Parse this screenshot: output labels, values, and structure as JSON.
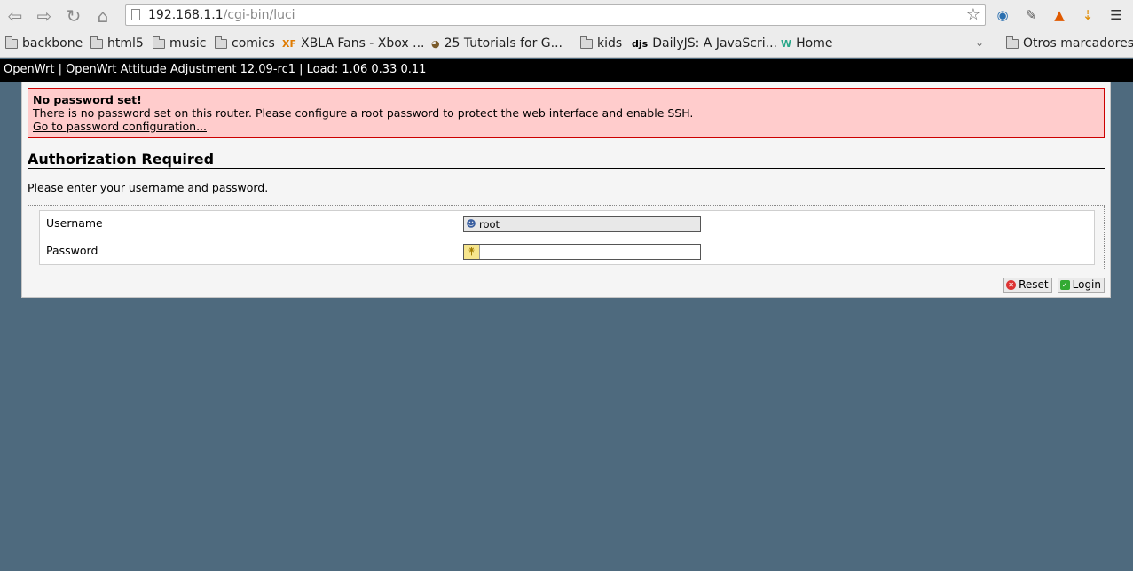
{
  "browser": {
    "url_host": "192.168.1.1",
    "url_path": "/cgi-bin/luci",
    "bookmarks": [
      {
        "label": "backbone",
        "icon": "folder-icon"
      },
      {
        "label": "html5",
        "icon": "folder-icon"
      },
      {
        "label": "music",
        "icon": "folder-icon"
      },
      {
        "label": "comics",
        "icon": "folder-icon"
      },
      {
        "label": "XBLA Fans - Xbox ...",
        "icon": "xf-icon"
      },
      {
        "label": "25 Tutorials for G...",
        "icon": "tutorials-icon"
      },
      {
        "label": "kids",
        "icon": "folder-icon"
      },
      {
        "label": "DailyJS: A JavaScri...",
        "icon": "djs-icon"
      },
      {
        "label": "Home",
        "icon": "w-icon"
      }
    ],
    "other_bookmarks": "Otros marcadores",
    "xf_glyph": "XF",
    "djs_glyph": "djs",
    "w_glyph": "W"
  },
  "header": {
    "text": "OpenWrt | OpenWrt Attitude Adjustment 12.09-rc1 | Load: 1.06 0.33 0.11"
  },
  "alert": {
    "title": "No password set!",
    "message": "There is no password set on this router. Please configure a root password to protect the web interface and enable SSH.",
    "link": "Go to password configuration..."
  },
  "auth": {
    "title": "Authorization Required",
    "description": "Please enter your username and password.",
    "username_label": "Username",
    "username_value": "root",
    "password_label": "Password",
    "password_value": ""
  },
  "actions": {
    "reset": "Reset",
    "login": "Login"
  },
  "colors": {
    "page_bg": "#4e6a7e",
    "alert_bg": "#ffcccc",
    "alert_border": "#cc0000",
    "header_bg": "#000000"
  }
}
